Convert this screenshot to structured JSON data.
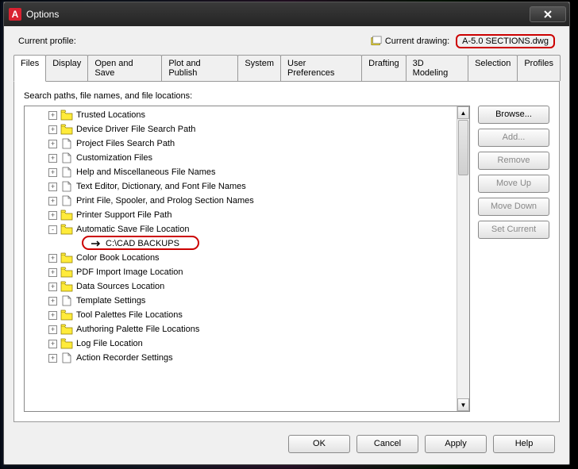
{
  "window": {
    "title": "Options"
  },
  "profile": {
    "label": "Current profile:",
    "drawing_label": "Current drawing:",
    "drawing_name": "A-5.0 SECTIONS.dwg"
  },
  "tabs": [
    {
      "label": "Files",
      "active": true
    },
    {
      "label": "Display"
    },
    {
      "label": "Open and Save"
    },
    {
      "label": "Plot and Publish"
    },
    {
      "label": "System"
    },
    {
      "label": "User Preferences"
    },
    {
      "label": "Drafting"
    },
    {
      "label": "3D Modeling"
    },
    {
      "label": "Selection"
    },
    {
      "label": "Profiles"
    }
  ],
  "panel": {
    "label": "Search paths, file names, and file locations:"
  },
  "tree": [
    {
      "icon": "folder",
      "label": "Trusted Locations",
      "toggle": "+"
    },
    {
      "icon": "folder",
      "label": "Device Driver File Search Path",
      "toggle": "+"
    },
    {
      "icon": "page",
      "label": "Project Files Search Path",
      "toggle": "+"
    },
    {
      "icon": "page",
      "label": "Customization Files",
      "toggle": "+"
    },
    {
      "icon": "page",
      "label": "Help and Miscellaneous File Names",
      "toggle": "+"
    },
    {
      "icon": "page",
      "label": "Text Editor, Dictionary, and Font File Names",
      "toggle": "+"
    },
    {
      "icon": "page",
      "label": "Print File, Spooler, and Prolog Section Names",
      "toggle": "+"
    },
    {
      "icon": "folder",
      "label": "Printer Support File Path",
      "toggle": "+"
    },
    {
      "icon": "folder",
      "label": "Automatic Save File Location",
      "toggle": "-",
      "expanded": true,
      "children": [
        {
          "icon": "arrow",
          "label": "C:\\CAD BACKUPS"
        }
      ]
    },
    {
      "icon": "folder",
      "label": "Color Book Locations",
      "toggle": "+"
    },
    {
      "icon": "folder",
      "label": "PDF Import Image Location",
      "toggle": "+"
    },
    {
      "icon": "folder",
      "label": "Data Sources Location",
      "toggle": "+"
    },
    {
      "icon": "page",
      "label": "Template Settings",
      "toggle": "+"
    },
    {
      "icon": "folder",
      "label": "Tool Palettes File Locations",
      "toggle": "+"
    },
    {
      "icon": "folder",
      "label": "Authoring Palette File Locations",
      "toggle": "+"
    },
    {
      "icon": "folder",
      "label": "Log File Location",
      "toggle": "+"
    },
    {
      "icon": "page",
      "label": "Action Recorder Settings",
      "toggle": "+"
    }
  ],
  "side_buttons": [
    {
      "label": "Browse...",
      "enabled": true
    },
    {
      "label": "Add...",
      "enabled": false
    },
    {
      "label": "Remove",
      "enabled": false
    },
    {
      "label": "Move Up",
      "enabled": false
    },
    {
      "label": "Move Down",
      "enabled": false
    },
    {
      "label": "Set Current",
      "enabled": false
    }
  ],
  "bottom_buttons": [
    {
      "label": "OK"
    },
    {
      "label": "Cancel"
    },
    {
      "label": "Apply"
    },
    {
      "label": "Help"
    }
  ]
}
